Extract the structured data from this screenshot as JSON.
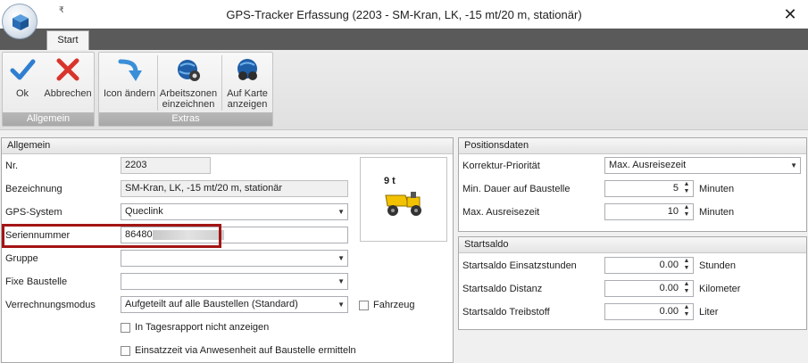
{
  "window": {
    "title": "GPS-Tracker Erfassung (2203 - SM-Kran, LK, -15 mt/20 m, stationär)",
    "qa_menu": "₹",
    "close": "✕"
  },
  "ribbon": {
    "tabs": [
      {
        "label": "Start"
      }
    ],
    "groups": {
      "allgemein": {
        "caption": "Allgemein",
        "ok": "Ok",
        "abbrechen": "Abbrechen"
      },
      "extras": {
        "caption": "Extras",
        "icon_aendern": "Icon ändern",
        "arbeitszonen_1": "Arbeitszonen",
        "arbeitszonen_2": "einzeichnen",
        "karte_1": "Auf Karte",
        "karte_2": "anzeigen"
      }
    }
  },
  "allgemein": {
    "header": "Allgemein",
    "nr_label": "Nr.",
    "nr_value": "2203",
    "bezeichnung_label": "Bezeichnung",
    "bezeichnung_value": "SM-Kran, LK, -15 mt/20 m, stationär",
    "gps_label": "GPS-System",
    "gps_value": "Queclink",
    "serien_label": "Seriennummer",
    "serien_value": "86480",
    "gruppe_label": "Gruppe",
    "gruppe_value": "",
    "baustelle_label": "Fixe Baustelle",
    "baustelle_value": "",
    "verrechnung_label": "Verrechnungsmodus",
    "verrechnung_value": "Aufgeteilt auf alle Baustellen (Standard)",
    "fahrzeug_label": "Fahrzeug",
    "tagesrapport_label": "In Tagesrapport nicht anzeigen",
    "einsatzzeit_label": "Einsatzzeit via Anwesenheit auf Baustelle ermitteln",
    "picture_text": "9 t"
  },
  "positionsdaten": {
    "header": "Positionsdaten",
    "korrektur_label": "Korrektur-Priorität",
    "korrektur_value": "Max. Ausreisezeit",
    "min_dauer_label": "Min. Dauer auf Baustelle",
    "min_dauer_value": "5",
    "min_dauer_unit": "Minuten",
    "max_aus_label": "Max. Ausreisezeit",
    "max_aus_value": "10",
    "max_aus_unit": "Minuten"
  },
  "startsaldo": {
    "header": "Startsaldo",
    "stunden_label": "Startsaldo Einsatzstunden",
    "stunden_value": "0.00",
    "stunden_unit": "Stunden",
    "distanz_label": "Startsaldo Distanz",
    "distanz_value": "0.00",
    "distanz_unit": "Kilometer",
    "treibstoff_label": "Startsaldo Treibstoff",
    "treibstoff_value": "0.00",
    "treibstoff_unit": "Liter"
  },
  "colors": {
    "highlight": "#a31515",
    "tabstrip": "#5a5a5a",
    "ok_check": "#2f7fd1",
    "cancel_x": "#d9342b"
  }
}
